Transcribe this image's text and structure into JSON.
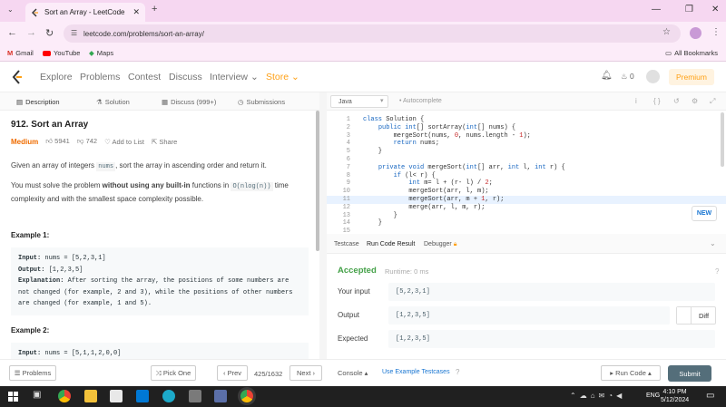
{
  "browser": {
    "tab_title": "Sort an Array - LeetCode",
    "url": "leetcode.com/problems/sort-an-array/",
    "bookmarks": [
      "Gmail",
      "YouTube",
      "Maps"
    ],
    "all_bookmarks": "All Bookmarks"
  },
  "nav": {
    "items": [
      "Explore",
      "Problems",
      "Contest",
      "Discuss",
      "Interview",
      "Store"
    ],
    "notif_count": "0",
    "premium": "Premium"
  },
  "left_tabs": [
    "Description",
    "Solution",
    "Discuss (999+)",
    "Submissions"
  ],
  "problem": {
    "title": "912. Sort an Array",
    "difficulty": "Medium",
    "likes": "5941",
    "dislikes": "742",
    "add_to_list": "Add to List",
    "share": "Share",
    "p1_pre": "Given an array of integers",
    "p1_code": "nums",
    "p1_post": ", sort the array in ascending order and return it.",
    "p2_pre": "You must solve the problem",
    "p2_bold": "without using any built-in",
    "p2_mid": "functions in",
    "p2_code": "O(nlog(n))",
    "p2_post": "time complexity and with the smallest space complexity possible.",
    "ex1_title": "Example 1:",
    "ex1_input_label": "Input:",
    "ex1_input": "nums = [5,2,3,1]",
    "ex1_output_label": "Output:",
    "ex1_output": "[1,2,3,5]",
    "ex1_expl_label": "Explanation:",
    "ex1_expl": "After sorting the array, the positions of some numbers are not changed (for example, 2 and 3), while the positions of other numbers are changed (for example, 1 and 5).",
    "ex2_title": "Example 2:",
    "ex2_input_label": "Input:",
    "ex2_input": "nums = [5,1,1,2,0,0]"
  },
  "editor": {
    "language": "Java",
    "autocomplete": "Autocomplete",
    "lines": [
      {
        "n": "1",
        "text": "class Solution {"
      },
      {
        "n": "2",
        "text": "    public int[] sortArray(int[] nums) {"
      },
      {
        "n": "3",
        "text": "        mergeSort(nums, 0, nums.length - 1);"
      },
      {
        "n": "4",
        "text": "        return nums;"
      },
      {
        "n": "5",
        "text": "    }"
      },
      {
        "n": "6",
        "text": ""
      },
      {
        "n": "7",
        "text": "    private void mergeSort(int[] arr, int l, int r) {"
      },
      {
        "n": "8",
        "text": "        if (l< r) {"
      },
      {
        "n": "9",
        "text": "            int m= l + (r- l) / 2;"
      },
      {
        "n": "10",
        "text": "            mergeSort(arr, l, m);"
      },
      {
        "n": "11",
        "text": "            mergeSort(arr, m + 1, r);"
      },
      {
        "n": "12",
        "text": "            merge(arr, l, m, r);"
      },
      {
        "n": "13",
        "text": "        }"
      },
      {
        "n": "14",
        "text": "    }"
      },
      {
        "n": "15",
        "text": ""
      }
    ],
    "new_badge": "NEW"
  },
  "console": {
    "tabs": [
      "Testcase",
      "Run Code Result",
      "Debugger"
    ],
    "status": "Accepted",
    "runtime": "Runtime: 0 ms",
    "your_input_label": "Your input",
    "your_input": "[5,2,3,1]",
    "output_label": "Output",
    "output": "[1,2,3,5]",
    "diff": "Diff",
    "expected_label": "Expected",
    "expected": "[1,2,3,5]"
  },
  "bottom": {
    "problems": "Problems",
    "pick_one": "Pick One",
    "prev": "Prev",
    "counter": "425/1632",
    "next": "Next",
    "console": "Console",
    "use_example": "Use Example Testcases",
    "run_code": "Run Code",
    "submit": "Submit"
  },
  "taskbar": {
    "time": "4:10 PM",
    "date": "5/12/2024",
    "lang": "ENG"
  }
}
